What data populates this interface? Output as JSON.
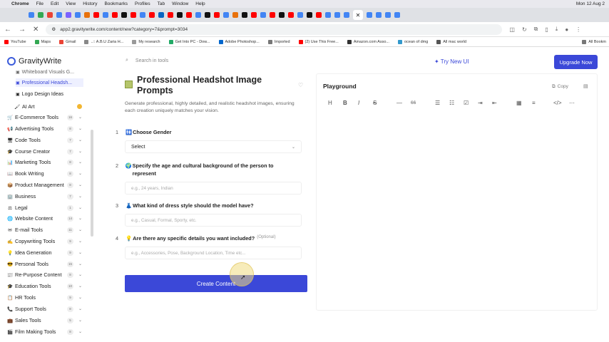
{
  "menubar": {
    "app": "Chrome",
    "items": [
      "File",
      "Edit",
      "View",
      "History",
      "Bookmarks",
      "Profiles",
      "Tab",
      "Window",
      "Help"
    ],
    "clock": "Mon 12 Aug 2"
  },
  "address": {
    "url": "app2.gravitywrite.com/content/new?category=7&prompt=3034"
  },
  "bookmarks": [
    "YouTube",
    "Maps",
    "Gmail",
    "..:: A.B.U Zaria H...",
    "My research",
    "Get Into PC - Dow...",
    "Adobe Photoshop...",
    "Imported",
    "(2) Use This Free...",
    "Amazon.com Asso...",
    "ocean of dmg",
    "All mac world",
    "All Bookm"
  ],
  "header": {
    "logo": "GravityWrite",
    "search_placeholder": "Search in tools",
    "try_new_ui": "Try New UI",
    "upgrade": "Upgrade Now"
  },
  "sidebar": {
    "subitems": [
      {
        "label": "Whiteboard Visuals G...",
        "icon": "image-icon"
      },
      {
        "label": "Professional Headsh...",
        "icon": "image-icon",
        "active": true
      },
      {
        "label": "Logo Design Ideas",
        "icon": "image-icon"
      }
    ],
    "ai_art": "AI Art",
    "items": [
      {
        "label": "E-Commerce Tools",
        "count": "16"
      },
      {
        "label": "Advertising Tools",
        "count": "8"
      },
      {
        "label": "Code Tools",
        "count": "7"
      },
      {
        "label": "Course Creator",
        "count": "7"
      },
      {
        "label": "Marketing Tools",
        "count": "8"
      },
      {
        "label": "Book Writing",
        "count": "8"
      },
      {
        "label": "Product Management",
        "count": "8"
      },
      {
        "label": "Business",
        "count": "7"
      },
      {
        "label": "Legal",
        "count": "1"
      },
      {
        "label": "Website Content",
        "count": "14"
      },
      {
        "label": "E-mail Tools",
        "count": "11"
      },
      {
        "label": "Copywriting Tools",
        "count": "9"
      },
      {
        "label": "Idea Generation",
        "count": "9"
      },
      {
        "label": "Personal Tools",
        "count": "15"
      },
      {
        "label": "Re-Purpose Content",
        "count": "8"
      },
      {
        "label": "Education Tools",
        "count": "10"
      },
      {
        "label": "HR Tools",
        "count": "9"
      },
      {
        "label": "Support Tools",
        "count": "8"
      },
      {
        "label": "Sales Tools",
        "count": "5"
      },
      {
        "label": "Film Making Tools",
        "count": "8"
      }
    ]
  },
  "form": {
    "title": "Professional Headshot Image Prompts",
    "description": "Generate professional, highly detailed, and realistic headshot images, ensuring each creation uniquely matches your vision.",
    "q1": {
      "num": "1",
      "label": "Choose Gender",
      "value": "Select"
    },
    "q2": {
      "num": "2",
      "label": "Specify the age and cultural background of the person to represent",
      "placeholder": "e.g., 24 years, Indian"
    },
    "q3": {
      "num": "3",
      "label": "What kind of dress style should the model have?",
      "placeholder": "e.g., Casual, Formal, Sporty, etc."
    },
    "q4": {
      "num": "4",
      "label": "Are there any specific details you want included?",
      "optional": "(Optional)",
      "placeholder": "e.g., Accessories, Pose, Background Location, Time etc..."
    },
    "create": "Create Content"
  },
  "playground": {
    "title": "Playground",
    "copy": "Copy",
    "toolbar": [
      "H",
      "B",
      "I",
      "S",
      "—",
      "66"
    ]
  },
  "colors": {
    "accent": "#3b48d8"
  }
}
